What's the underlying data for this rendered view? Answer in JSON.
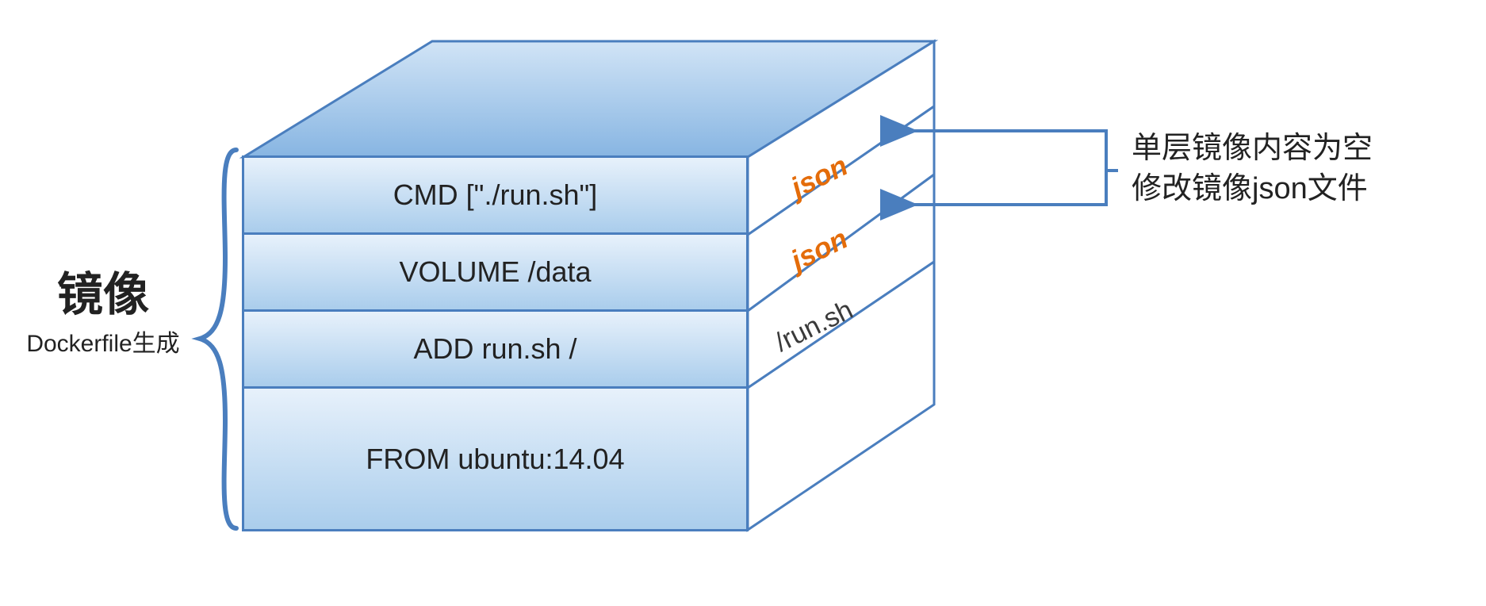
{
  "left_label": {
    "title": "镜像",
    "subtitle": "Dockerfile生成"
  },
  "layers": [
    {
      "front_text": "CMD [\"./run.sh\"]",
      "side_text": "json",
      "side_orange": true
    },
    {
      "front_text": "VOLUME /data",
      "side_text": "json",
      "side_orange": true
    },
    {
      "front_text": "ADD run.sh /",
      "side_text": "/run.sh",
      "side_orange": false
    },
    {
      "front_text": "FROM ubuntu:14.04",
      "side_text": "",
      "side_orange": false
    }
  ],
  "annotation": {
    "line1": "单层镜像内容为空",
    "line2": "修改镜像json文件"
  }
}
